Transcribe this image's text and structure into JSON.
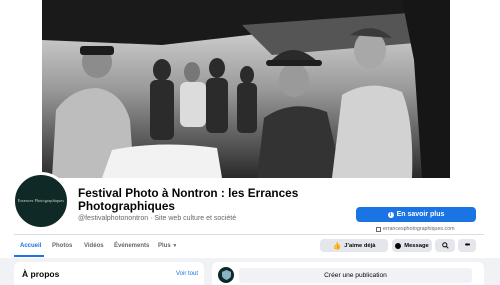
{
  "page": {
    "title": "Festival Photo à Nontron : les Errances Photographiques",
    "subtitle": "@festivalphotonontron · Site web culture et société",
    "avatar_text": "Errances Photographiques"
  },
  "actions": {
    "learn_more": "En savoir plus",
    "website": "errancesphotographiques.com",
    "like": "J’aime déjà",
    "message": "Message"
  },
  "tabs": [
    {
      "label": "Accueil"
    },
    {
      "label": "Photos"
    },
    {
      "label": "Vidéos"
    },
    {
      "label": "Événements"
    },
    {
      "label": "Plus"
    }
  ],
  "about": {
    "title": "À propos",
    "see_all": "Voir tout"
  },
  "composer": {
    "placeholder": "Créer une publication"
  },
  "colors": {
    "accent": "#1b74e4",
    "background": "#f0f2f5"
  },
  "icons": [
    "info-icon",
    "external-link-icon",
    "thumbs-up-icon",
    "messenger-icon",
    "search-icon",
    "more-icon",
    "chevron-down-icon"
  ]
}
